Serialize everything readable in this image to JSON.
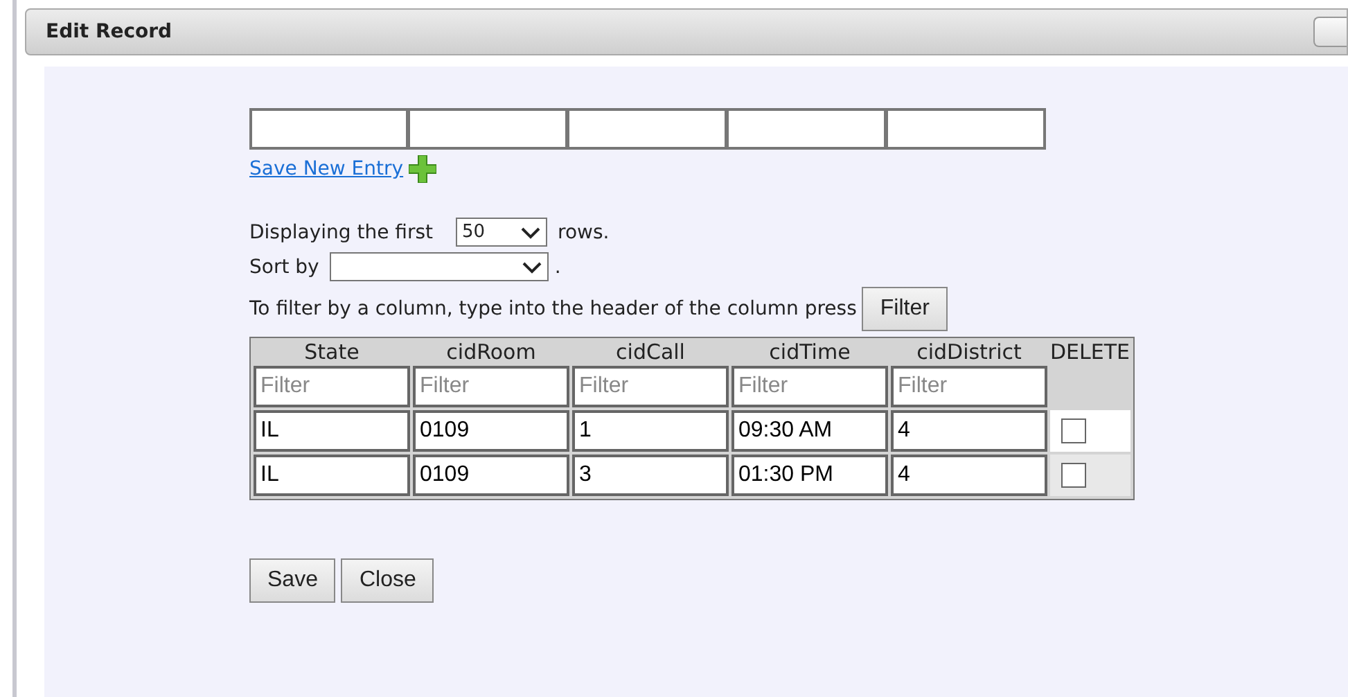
{
  "dialog": {
    "title": "Edit Record"
  },
  "new_entry": {
    "fields": [
      {
        "kind": "text"
      },
      {
        "kind": "text"
      },
      {
        "kind": "text"
      },
      {
        "kind": "text"
      },
      {
        "kind": "text"
      }
    ],
    "save_link": "Save New Entry"
  },
  "paging": {
    "label": "Displaying the first",
    "value": "50",
    "suffix": "rows."
  },
  "sort": {
    "label": "Sort by",
    "suffix": "."
  },
  "filter": {
    "hint": "To filter by a column, type into the header of the column press",
    "button": "Filter"
  },
  "table": {
    "columns": [
      {
        "label": "State",
        "placeholder": "Filter"
      },
      {
        "label": "cidRoom",
        "placeholder": "Filter"
      },
      {
        "label": "cidCall",
        "placeholder": "Filter"
      },
      {
        "label": "cidTime",
        "placeholder": "Filter"
      },
      {
        "label": "cidDistrict",
        "placeholder": "Filter"
      }
    ],
    "delete_label": "DELETE",
    "rows": [
      {
        "cells": [
          "IL",
          "0109",
          "1",
          "09:30 AM",
          "4"
        ],
        "delete": false
      },
      {
        "cells": [
          "IL",
          "0109",
          "3",
          "01:30 PM",
          "4"
        ],
        "delete": false
      }
    ]
  },
  "buttons": [
    "Save",
    "Close"
  ]
}
